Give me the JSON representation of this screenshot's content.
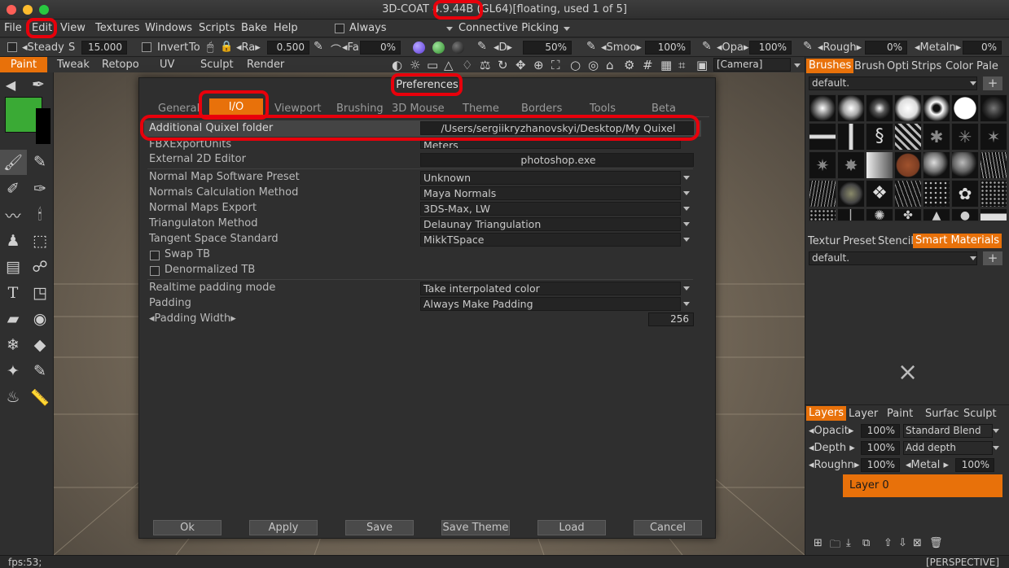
{
  "window": {
    "title": "3D-COAT 4.9.44B (GL64)[floating, used 1 of 5]"
  },
  "menu": [
    "File",
    "Edit",
    "View",
    "Textures",
    "Windows",
    "Scripts",
    "Bake",
    "Help"
  ],
  "toolbar_top": {
    "always_label": "Always",
    "connective_label": "Connective Picking"
  },
  "toolbar2": {
    "steady_label": "Steady",
    "s_label": "S",
    "s_value": "15.000",
    "invert_label": "Invert",
    "to_label": "To",
    "ra_label": "Ra",
    "ra_value": "0.500",
    "fal_label": "Fal",
    "fal_value": "0%",
    "d_label": "D",
    "d_value": "50%",
    "smoo_label": "Smoo",
    "smoo_value": "100%",
    "opa_label": "Opa",
    "opa_value": "100%",
    "rough_label": "Rough",
    "rough_value": "0%",
    "metal_label": "Metaln",
    "metal_value": "0%"
  },
  "rooms": [
    "Paint",
    "Tweak",
    "Retopo",
    "UV",
    "Sculpt",
    "Render"
  ],
  "camera_value": "[Camera]",
  "brush_panel": {
    "tabs": [
      "Brushes",
      "Brush",
      "Opti",
      "Strips",
      "Color",
      "Pale"
    ],
    "preset": "default."
  },
  "materials_panel": {
    "tabs": [
      "Textur",
      "Preset",
      "Stencil",
      "Smart Materials"
    ],
    "preset": "default.",
    "close_glyph": "×"
  },
  "layers_panel": {
    "tabs": [
      "Layers",
      "Layer",
      "Paint",
      "Surfac",
      "Sculpt"
    ],
    "opacity_label": "Opacit",
    "opacity_value": "100%",
    "blend_value": "Standard Blend",
    "depth_label": "Depth",
    "depth_value": "100%",
    "depth_mode": "Add depth",
    "rough_label": "Roughn",
    "rough_value": "100%",
    "metal_label": "Metal",
    "metal_value": "100%",
    "layer_name": "Layer 0"
  },
  "status": {
    "fps": "fps:53;",
    "view_mode": "[PERSPECTIVE]"
  },
  "dialog": {
    "title": "Preferences",
    "tabs": [
      "General",
      "I/O",
      "Viewport",
      "Brushing",
      "3D Mouse",
      "Theme",
      "Borders",
      "Tools",
      "Beta"
    ],
    "quixel_label": "Additional Quixel folder",
    "quixel_value": "/Users/sergiikryzhanovskyi/Desktop/My Quixel",
    "fbx_label": "FBXExportUnits",
    "fbx_value": "Meters",
    "ext_label": "External 2D Editor",
    "ext_value": "photoshop.exe",
    "nm_preset_label": "Normal Map Software Preset",
    "nm_preset_value": "Unknown",
    "ncm_label": "Normals Calculation Method",
    "ncm_value": "Maya Normals",
    "nme_label": "Normal Maps Export",
    "nme_value": "3DS-Max, LW",
    "tri_label": "Triangulaton Method",
    "tri_value": "Delaunay Triangulation",
    "tss_label": "Tangent Space Standard",
    "tss_value": "MikkTSpace",
    "swap_label": "Swap TB",
    "denorm_label": "Denormalized TB",
    "rtpad_label": "Realtime padding mode",
    "rtpad_value": "Take interpolated color",
    "pad_label": "Padding",
    "pad_value": "Always Make Padding",
    "padw_label": "Padding Width",
    "padw_value": "256",
    "buttons": [
      "Ok",
      "Apply",
      "Save",
      "Save Theme",
      "Load",
      "Cancel"
    ]
  },
  "colors": {
    "accent": "#e8710a",
    "annotation": "#e8000b",
    "primary_swatch": "#3aaa35"
  }
}
